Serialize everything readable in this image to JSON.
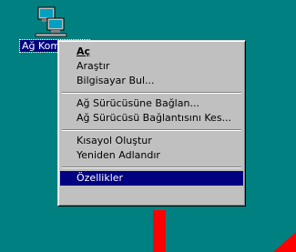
{
  "desktop": {
    "background_color": "#008080",
    "icon": {
      "name": "network-neighborhood-icon",
      "label": "Ağ Komşuları"
    }
  },
  "context_menu": {
    "groups": [
      [
        {
          "id": "open",
          "label": "Aç",
          "bold": true
        },
        {
          "id": "search",
          "label": "Araştır"
        },
        {
          "id": "find-computer",
          "label": "Bilgisayar Bul..."
        }
      ],
      [
        {
          "id": "map-drive",
          "label": "Ağ Sürücüsüne Bağlan..."
        },
        {
          "id": "disconnect-drive",
          "label": "Ağ Sürücüsü Bağlantısını Kes..."
        }
      ],
      [
        {
          "id": "create-shortcut",
          "label": "Kısayol Oluştur"
        },
        {
          "id": "rename",
          "label": "Yeniden Adlandır"
        }
      ],
      [
        {
          "id": "properties",
          "label": "Özellikler",
          "selected": true
        }
      ]
    ],
    "highlight_color": "#000080"
  },
  "annotations": {
    "arrow_color": "#ff0000"
  }
}
